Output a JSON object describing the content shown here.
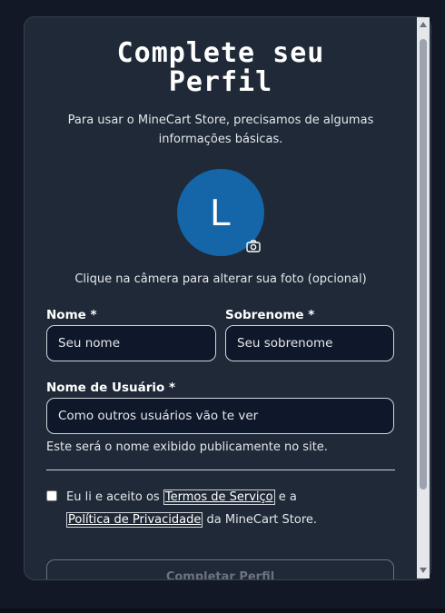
{
  "form": {
    "title_line1": "Complete seu",
    "title_line2": "Perfil",
    "subtitle_line1": "Para usar o MineCart Store, precisamos de algumas",
    "subtitle_line2": "informações básicas.",
    "avatar_letter": "L",
    "avatar_hint": "Clique na câmera para alterar sua foto (opcional)",
    "first_name_label": "Nome *",
    "first_name_placeholder": "Seu nome",
    "last_name_label": "Sobrenome *",
    "last_name_placeholder": "Seu sobrenome",
    "username_label": "Nome de Usuário *",
    "username_placeholder": "Como outros usuários vão te ver",
    "username_help": "Este será o nome exibido publicamente no site.",
    "terms_prefix": "Eu li e aceito os",
    "terms_link": "Termos de Serviço",
    "terms_middle": "e a",
    "privacy_link": "Política de Privacidade",
    "terms_suffix": "da MineCart Store.",
    "terms_checked": false,
    "submit_label": "Completar Perfil"
  },
  "icons": {
    "camera": "camera-icon",
    "checkbox": "checkbox-icon"
  },
  "colors": {
    "page_background": "#121826",
    "card_background": "#1f2937",
    "avatar_background": "#1565a9",
    "input_background": "#0f172a",
    "text": "#e5e7eb",
    "disabled_button_text": "#6b7280"
  }
}
